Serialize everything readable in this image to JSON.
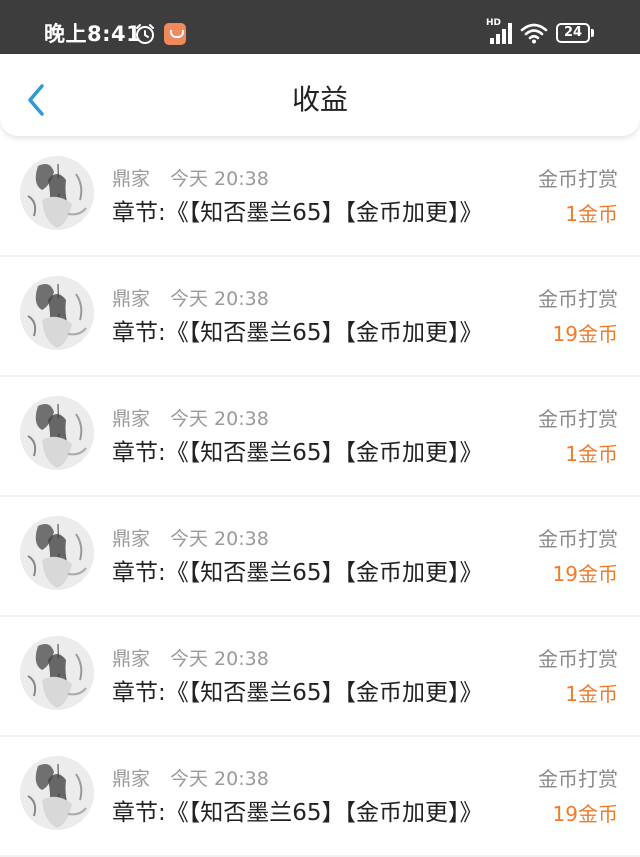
{
  "status_bar": {
    "time": "晚上8:41",
    "network": "HD",
    "battery": "24"
  },
  "header": {
    "title": "收益"
  },
  "colors": {
    "accent_blue": "#2f9bd6",
    "amount_orange": "#f07a2a",
    "status_bar_bg": "#3d3d3d"
  },
  "icons": {
    "back": "chevron-left-icon",
    "alarm": "alarm-clock-icon",
    "app": "app-notification-icon",
    "signal": "cellular-signal-icon",
    "wifi": "wifi-icon",
    "battery": "battery-icon"
  },
  "records": [
    {
      "name": "鼎家",
      "time": "今天 20:38",
      "chapter": "章节:《【知否墨兰65】【金币加更】》",
      "type": "金币打赏",
      "amount": "1金币"
    },
    {
      "name": "鼎家",
      "time": "今天 20:38",
      "chapter": "章节:《【知否墨兰65】【金币加更】》",
      "type": "金币打赏",
      "amount": "19金币"
    },
    {
      "name": "鼎家",
      "time": "今天 20:38",
      "chapter": "章节:《【知否墨兰65】【金币加更】》",
      "type": "金币打赏",
      "amount": "1金币"
    },
    {
      "name": "鼎家",
      "time": "今天 20:38",
      "chapter": "章节:《【知否墨兰65】【金币加更】》",
      "type": "金币打赏",
      "amount": "19金币"
    },
    {
      "name": "鼎家",
      "time": "今天 20:38",
      "chapter": "章节:《【知否墨兰65】【金币加更】》",
      "type": "金币打赏",
      "amount": "1金币"
    },
    {
      "name": "鼎家",
      "time": "今天 20:38",
      "chapter": "章节:《【知否墨兰65】【金币加更】》",
      "type": "金币打赏",
      "amount": "19金币"
    }
  ]
}
